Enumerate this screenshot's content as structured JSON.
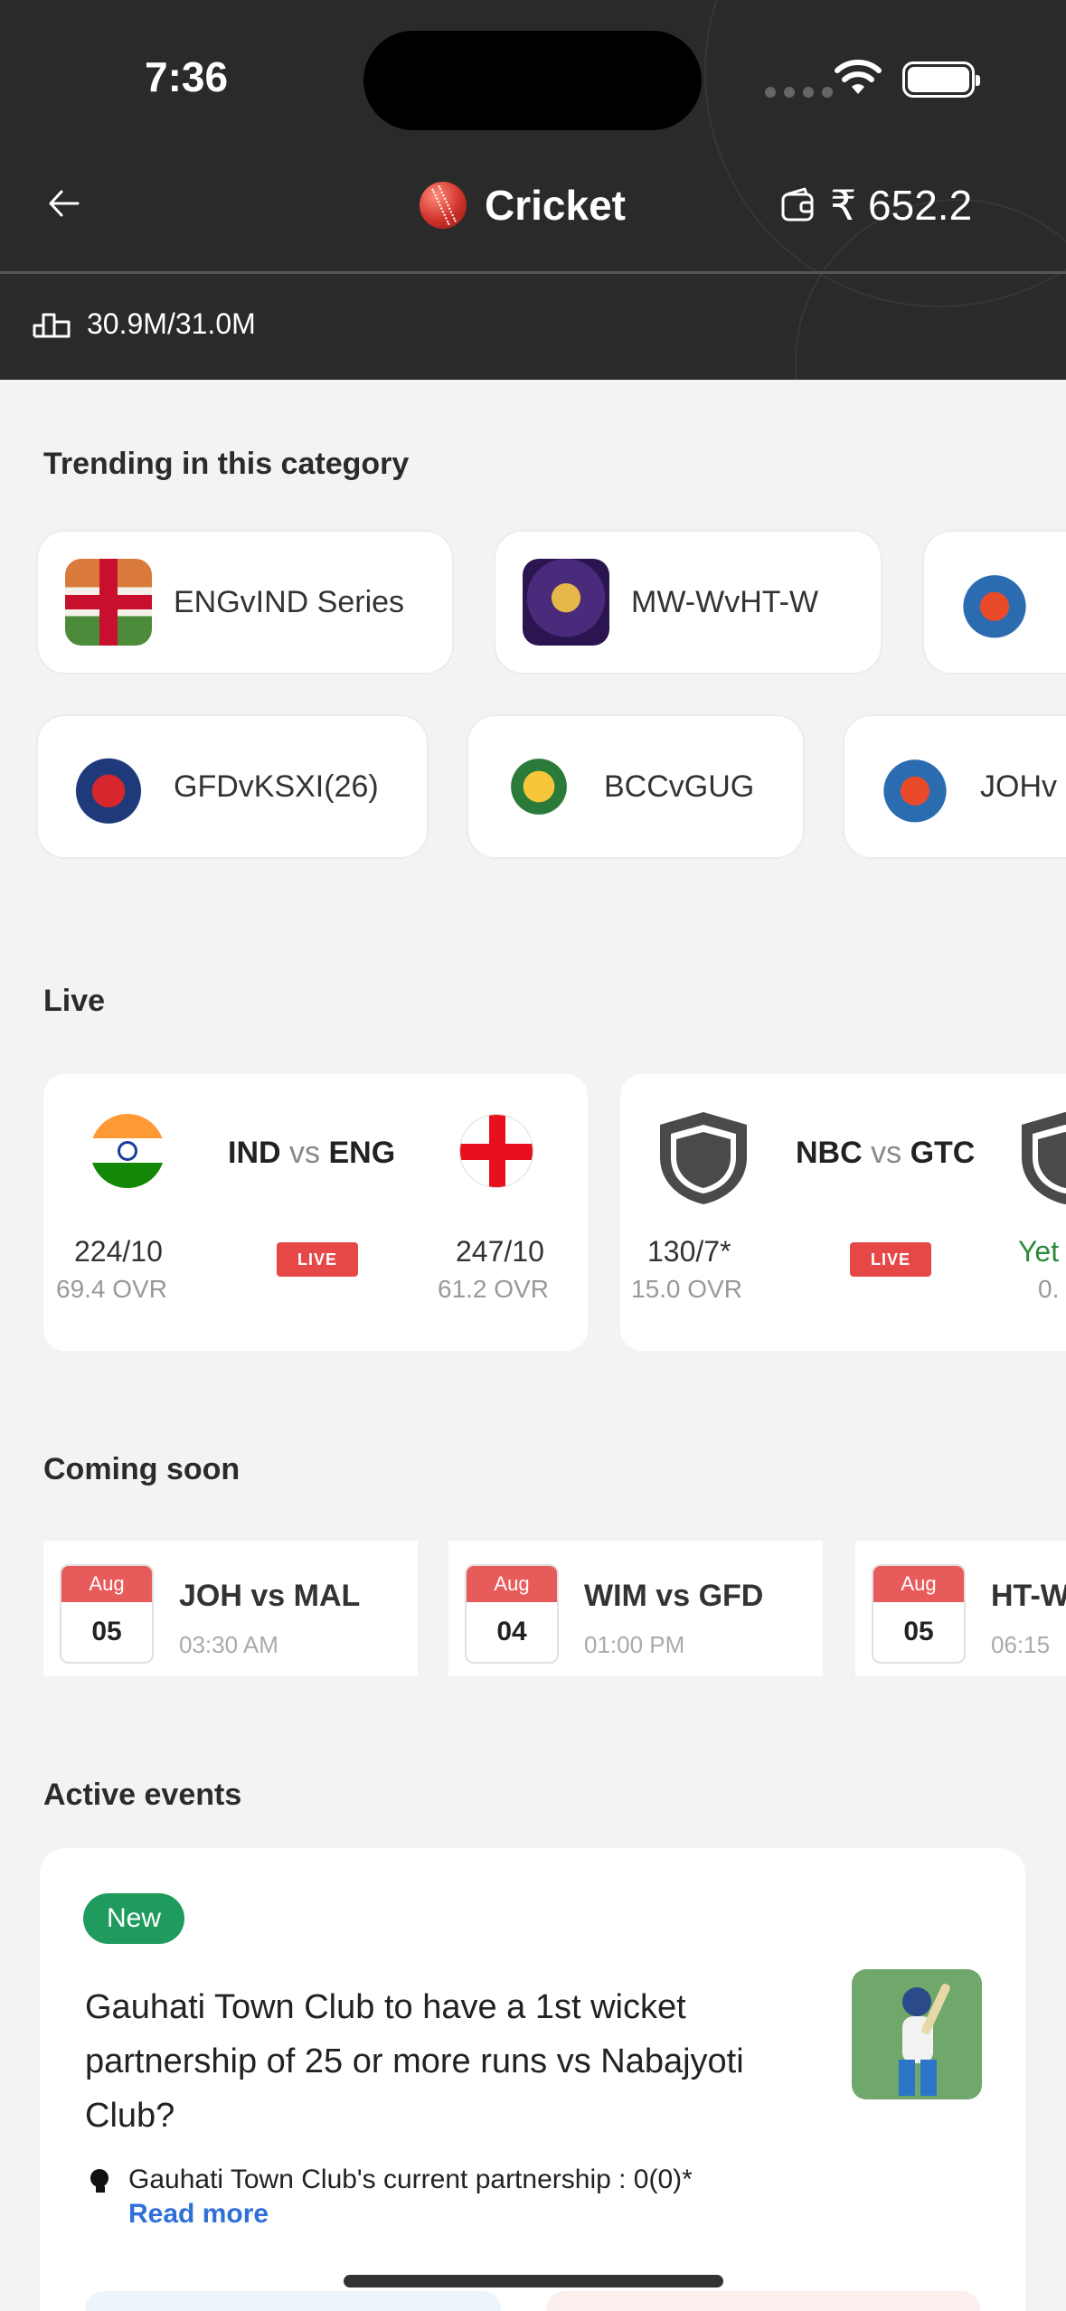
{
  "status_bar": {
    "time": "7:36"
  },
  "header": {
    "title": "Cricket",
    "wallet_balance": "₹ 652.2",
    "volume": "30.9M/31.0M"
  },
  "icons": {
    "back": "back-arrow-icon",
    "sport": "cricket-ball-icon",
    "wallet": "wallet-icon",
    "volume": "bar-chart-icon",
    "info": "lightbulb-icon"
  },
  "trending": {
    "title": "Trending in this category",
    "row1": [
      {
        "label": "ENGvIND Series"
      },
      {
        "label": "MW-WvHT-W"
      },
      {
        "label": ""
      }
    ],
    "row2": [
      {
        "label": "GFDvKSXI(26)"
      },
      {
        "label": "BCCvGUG"
      },
      {
        "label": "JOHv"
      }
    ]
  },
  "live": {
    "title": "Live",
    "badge": "LIVE",
    "matches": [
      {
        "team_a": "IND",
        "vs": "vs",
        "team_b": "ENG",
        "score_a": "224/10",
        "overs_a": "69.4 OVR",
        "score_b": "247/10",
        "overs_b": "61.2 OVR"
      },
      {
        "team_a": "NBC",
        "vs": "vs",
        "team_b": "GTC",
        "score_a": "130/7*",
        "overs_a": "15.0 OVR",
        "score_b": "Yet",
        "overs_b": "0."
      }
    ]
  },
  "coming_soon": {
    "title": "Coming soon",
    "matches": [
      {
        "month": "Aug",
        "day": "05",
        "title": "JOH vs MAL",
        "time": "03:30 AM"
      },
      {
        "month": "Aug",
        "day": "04",
        "title": "WIM vs GFD",
        "time": "01:00 PM"
      },
      {
        "month": "Aug",
        "day": "05",
        "title": "HT-W",
        "time": "06:15"
      }
    ]
  },
  "active_events": {
    "title": "Active events",
    "badge": "New",
    "question": "Gauhati Town Club to have a 1st wicket partnership of 25 or more runs vs Nabajyoti Club?",
    "info": "Gauhati Town Club's current partnership : 0(0)*",
    "read_more": "Read more"
  }
}
